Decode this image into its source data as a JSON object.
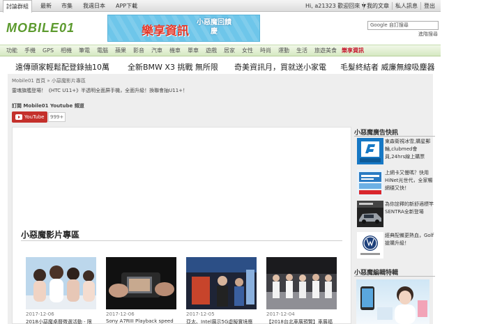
{
  "topnav": {
    "tabs": [
      "討論群組",
      "最新",
      "市集",
      "我週日本",
      "APP下載"
    ],
    "user_greeting": "Hi, a21323 歡迎回來 ▼",
    "links": [
      "我的文章",
      "私人訊息",
      "登出"
    ]
  },
  "header": {
    "logo_text": "MOBILE01",
    "banner_main": "樂享資訊",
    "banner_sub": "小惡魔回饋慶",
    "search_placeholder": "Google 自訂搜尋",
    "search_advanced": "進階搜尋"
  },
  "catnav": {
    "items": [
      "功能",
      "手機",
      "GPS",
      "相機",
      "筆電",
      "電腦",
      "蘋果",
      "影音",
      "汽車",
      "機車",
      "單車",
      "遊戲",
      "居家",
      "女性",
      "時尚",
      "運動",
      "生活",
      "旅遊美食",
      "樂享資訊"
    ],
    "highlight_color": "#c6162c"
  },
  "promos": [
    "遠傳頭家輕鬆配登錄抽10萬",
    "全新BMW X3 挑戰 無所限",
    "奇美資訊月，買就送小家電",
    "毛髮終結者 威廉無線吸塵器"
  ],
  "breadcrumb": "Mobile01 首頁 » 小惡魔影片專區",
  "notice": "靈魂旗艦登場！《HTC U11+》半透明全面屏手機，全面升級！換聯會抽U11+！",
  "subscribe": {
    "label": "訂閱 Mobile01 Youtube 頻道",
    "button": "YouTube",
    "count": "999+"
  },
  "main": {
    "section_title": "小惡魔影片專區",
    "videos": [
      {
        "date": "2017-12-06",
        "title": "2018小惡魔桌曆徵選活動 - 限"
      },
      {
        "date": "2017-12-06",
        "title": "Sony A7RIII Playback speed"
      },
      {
        "date": "2017-12-05",
        "title": "亞太、Intel展示5G虛擬實境應"
      },
      {
        "date": "2017-12-04",
        "title": "【2018台北車展預覽】車展福"
      }
    ]
  },
  "sidebar": {
    "ads_title": "小惡魔廣告快訊",
    "ads": [
      {
        "text": "東森衛視冰雪,購星郵輪,clubmed會員,24hrs線上購票"
      },
      {
        "text": "上網卡又慢嗎？快用HiNet光世代，全家暢網穩又快！"
      },
      {
        "text": "為你詮釋的新舒適標竿 SENTRA全新登場"
      },
      {
        "text": "經典配備更熱血，Golf搶購升級！"
      }
    ],
    "ads_icons": [
      "fubon-icon",
      "hinet-icon",
      "sentra-car-icon",
      "volkswagen-icon"
    ],
    "feature_title": "小惡魔編輯特輯"
  }
}
